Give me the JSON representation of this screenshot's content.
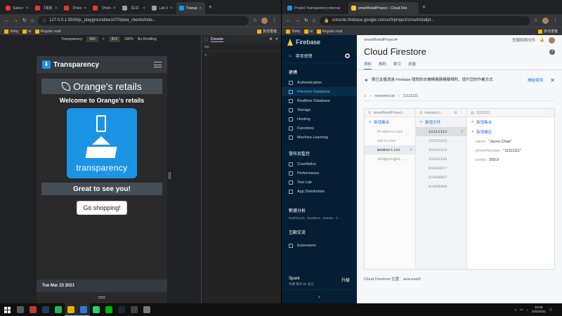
{
  "left_window": {
    "tabs": [
      {
        "label": "Subscr",
        "active": false
      },
      {
        "label": "【電影",
        "active": false
      },
      {
        "label": "【Holo",
        "active": false
      },
      {
        "label": "【Holo",
        "active": false
      },
      {
        "label": "【E3】",
        "active": false
      },
      {
        "label": "Lab 3",
        "active": false
      },
      {
        "label": "Transp",
        "active": true
      }
    ],
    "url": "127.0.0.1:5500/js_playground/ee1070/pwa_clients/inde...",
    "bookmarks": [
      "Shitty",
      "lul",
      "Regular read",
      "其他書籤"
    ],
    "devtools": {
      "device": "Transparency",
      "width": "442",
      "height": "813",
      "zoom": "100%",
      "throttle": "No throttling",
      "console_tab": "Console",
      "context": "top",
      "prompt": ">"
    },
    "app": {
      "brand": "Transparency",
      "shop_title": "Orange's retails",
      "welcome": "Welcome to Orange's retails",
      "logo_text": "transparency",
      "greeting": "Great to see you!",
      "go_button": "Go shopping!",
      "date": "Tue Mar 23 2021"
    }
  },
  "right_window": {
    "tabs": [
      {
        "label": "Project Transparency internal",
        "active": false
      },
      {
        "label": "smartRetailProject – Cloud Fire",
        "active": true
      }
    ],
    "url": "console.firebase.google.com/u/0/project/smartretailpr...",
    "bookmarks": [
      "Shitty",
      "lul",
      "Regular read",
      "其他書籤"
    ],
    "firebase": {
      "product": "Firebase",
      "overview": "專案總覽",
      "build_section": "建構",
      "build_items": [
        {
          "label": "Authentication",
          "active": false
        },
        {
          "label": "Firestore Database",
          "active": true
        },
        {
          "label": "Realtime Database",
          "active": false
        },
        {
          "label": "Storage",
          "active": false
        },
        {
          "label": "Hosting",
          "active": false
        },
        {
          "label": "Functions",
          "active": false
        },
        {
          "label": "Machine Learning",
          "active": false
        }
      ],
      "release_section": "發布及監控",
      "release_items": [
        "Crashlytics",
        "Performance",
        "Test Lab",
        "App Distribution"
      ],
      "analytics_section": "數據分析",
      "analytics_sub": "Dashboard、Realtime、Events、C...",
      "engage_section": "互動交流",
      "extensions": "Extensions",
      "plan": "Spark",
      "plan_sub": "免費 每月 $0 美元",
      "upgrade": "升級",
      "project_name": "smartRetailProject",
      "docs_link": "查閱說明文件",
      "page_title": "Cloud Firestore",
      "tabs": [
        {
          "label": "資料",
          "active": true
        },
        {
          "label": "規則",
          "active": false
        },
        {
          "label": "索引",
          "active": false
        },
        {
          "label": "用量",
          "active": false
        }
      ],
      "banner_text": "現已支援透過 Firebase 隨附的本機模擬器模擬規則，提升您的作業方式",
      "banner_button": "開始使用",
      "breadcrumb": [
        "memberList",
        "11111111"
      ],
      "col1": {
        "header": "smartRetailProject-...",
        "add": "新增集合",
        "items": [
          {
            "label": "ProductList",
            "selected": false
          },
          {
            "label": "cartList",
            "selected": false
          },
          {
            "label": "memberList",
            "selected": true
          },
          {
            "label": "shoppingHi...",
            "selected": false
          }
        ]
      },
      "col2": {
        "header": "memberLi...",
        "add": "新增文件",
        "items": [
          {
            "label": "11111111",
            "selected": true
          },
          {
            "label": "22222222",
            "selected": false
          },
          {
            "label": "33332222",
            "selected": false
          },
          {
            "label": "33333333",
            "selected": false
          },
          {
            "label": "91828877",
            "selected": false
          },
          {
            "label": "91058067",
            "selected": false
          },
          {
            "label": "91058068",
            "selected": false
          }
        ]
      },
      "col3": {
        "header": "11111111",
        "add_collection": "新增集合",
        "add_field": "新增欄位",
        "fields": [
          {
            "key": "name:",
            "value": "\"Jason Chan\""
          },
          {
            "key": "phoneNumber:",
            "value": "\"11111111\""
          },
          {
            "key": "points:",
            "value": "209.9"
          }
        ]
      },
      "location": "Cloud Firestore 位置：asia-east2"
    }
  },
  "taskbar": {
    "time": "22:56",
    "date": "23/3/2021",
    "apps": [
      {
        "name": "td",
        "color": "#5a5a5a"
      },
      {
        "name": "acrobat",
        "color": "#c0392b"
      },
      {
        "name": "photoshop",
        "color": "#1f3a5f"
      },
      {
        "name": "spotify",
        "color": "#1db954"
      },
      {
        "name": "chrome",
        "color": "#e8b400"
      },
      {
        "name": "vscode",
        "color": "#2b7bd6"
      },
      {
        "name": "whatsapp",
        "color": "#25d366"
      },
      {
        "name": "line",
        "color": "#00b900"
      },
      {
        "name": "steam",
        "color": "#1b2838"
      },
      {
        "name": "epic",
        "color": "#444"
      },
      {
        "name": "obs",
        "color": "#777"
      }
    ]
  }
}
